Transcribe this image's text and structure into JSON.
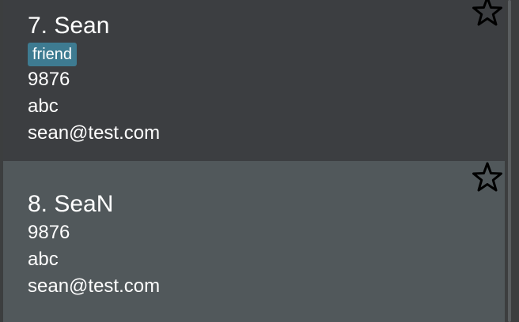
{
  "contacts": [
    {
      "title": "7. Sean",
      "tags": [
        "friend"
      ],
      "phone": "9876",
      "address": "abc",
      "email": "sean@test.com"
    },
    {
      "title": "8. SeaN",
      "tags": [],
      "phone": "9876",
      "address": "abc",
      "email": "sean@test.com"
    }
  ],
  "icons": {
    "favorite": "star-outline-icon"
  },
  "colors": {
    "card_default": "#3c3e41",
    "card_selected": "#51585b",
    "tag_background": "#3e7b91",
    "text": "#ffffff"
  }
}
